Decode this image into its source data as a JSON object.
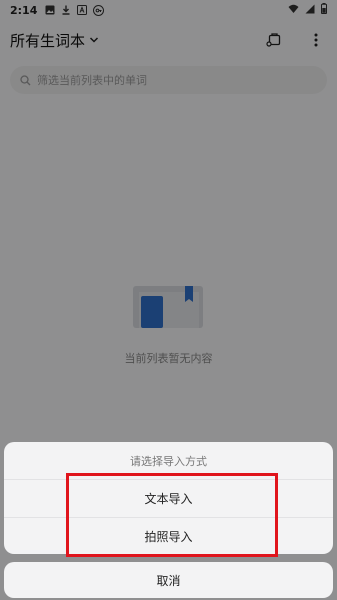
{
  "status_bar": {
    "time": "2:14",
    "icons": [
      "image-icon",
      "download-icon",
      "text-a-icon",
      "key-icon"
    ],
    "right_icons": [
      "wifi-icon",
      "signal-icon",
      "battery-icon"
    ]
  },
  "header": {
    "title": "所有生词本",
    "actions": [
      "bag-icon",
      "more-vert-icon"
    ]
  },
  "search": {
    "placeholder": "筛选当前列表中的单词"
  },
  "empty_state": {
    "text": "当前列表暂无内容"
  },
  "sheet": {
    "title": "请选择导入方式",
    "options": [
      {
        "label": "文本导入"
      },
      {
        "label": "拍照导入"
      }
    ],
    "cancel_label": "取消"
  },
  "colors": {
    "highlight": "#e0141c",
    "folder_blue": "#2f6fc8"
  }
}
